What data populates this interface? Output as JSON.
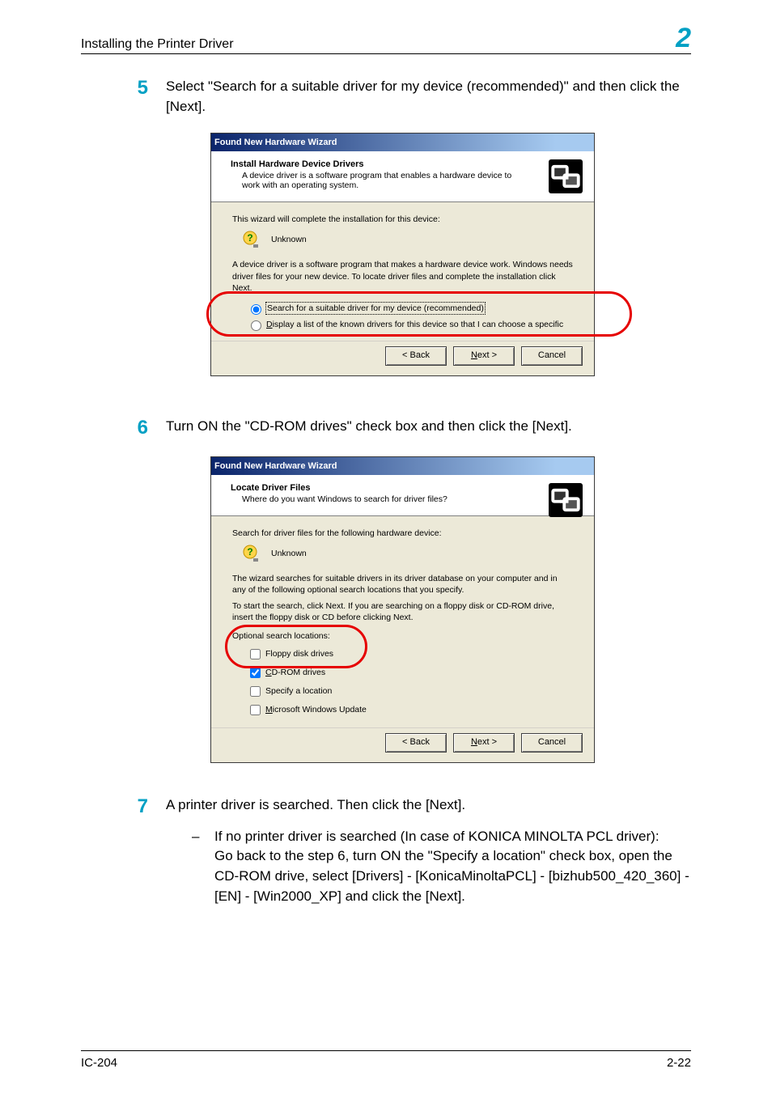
{
  "header": {
    "title": "Installing the Printer Driver",
    "chapter": "2"
  },
  "step5": {
    "num": "5",
    "text": "Select \"Search for a suitable driver for my device (recommended)\" and then click the [Next]."
  },
  "dialog1": {
    "title": "Found New Hardware Wizard",
    "banner_strong": "Install Hardware Device Drivers",
    "banner_sub": "A device driver is a software program that enables a hardware device to work with an operating system.",
    "body_line1": "This wizard will complete the installation for this device:",
    "unknown": "Unknown",
    "body_para": "A device driver is a software program that makes a hardware device work. Windows needs driver files for your new device. To locate driver files and complete the installation click Next.",
    "radio1": "Search for a suitable driver for my device (recommended)",
    "radio2": "Display a list of the known drivers for this device so that I can choose a specific",
    "back": "< Back",
    "next": "Next >",
    "cancel": "Cancel"
  },
  "step6": {
    "num": "6",
    "text": "Turn ON the \"CD-ROM drives\" check box and then click the [Next]."
  },
  "dialog2": {
    "title": "Found New Hardware Wizard",
    "banner_strong": "Locate Driver Files",
    "banner_sub": "Where do you want Windows to search for driver files?",
    "body_line1": "Search for driver files for the following hardware device:",
    "unknown": "Unknown",
    "para1": "The wizard searches for suitable drivers in its driver database on your computer and in any of the following optional search locations that you specify.",
    "para2": "To start the search, click Next. If you are searching on a floppy disk or CD-ROM drive, insert the floppy disk or CD before clicking Next.",
    "opt_label": "Optional search locations:",
    "chk1": "Floppy disk drives",
    "chk2": "CD-ROM drives",
    "chk3": "Specify a location",
    "chk4": "Microsoft Windows Update",
    "back": "< Back",
    "next": "Next >",
    "cancel": "Cancel"
  },
  "step7": {
    "num": "7",
    "text": "A printer driver is searched. Then click the [Next].",
    "bullet_lead": "If no printer driver is searched (In case of KONICA MINOLTA PCL driver):",
    "bullet_body": "Go back to the step 6, turn ON the \"Specify a location\" check box, open the CD-ROM drive, select [Drivers] - [KonicaMinoltaPCL] - [bizhub500_420_360] - [EN] - [Win2000_XP] and click the [Next]."
  },
  "footer": {
    "left": "IC-204",
    "right": "2-22"
  }
}
